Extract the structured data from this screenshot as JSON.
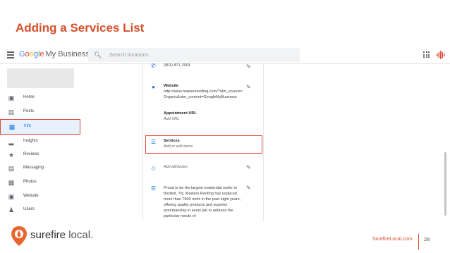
{
  "slide": {
    "title": "Adding a Services List",
    "footer_url": "SurefireLocal.com",
    "page_number": "28"
  },
  "topbar": {
    "logo_google": "Google",
    "logo_suffix": "My Business",
    "search_placeholder": "Search locations"
  },
  "sidebar": {
    "items": [
      {
        "label": "Home",
        "icon": "home-icon"
      },
      {
        "label": "Posts",
        "icon": "posts-icon"
      },
      {
        "label": "Info",
        "icon": "storefront-icon",
        "active": true
      },
      {
        "label": "Insights",
        "icon": "bar-chart-icon"
      },
      {
        "label": "Reviews",
        "icon": "star-icon"
      },
      {
        "label": "Messaging",
        "icon": "message-icon"
      },
      {
        "label": "Photos",
        "icon": "photos-icon"
      },
      {
        "label": "Website",
        "icon": "website-icon"
      },
      {
        "label": "Users",
        "icon": "add-user-icon"
      }
    ]
  },
  "info_panel": {
    "phone": "(901) 871-7663",
    "website_label": "Website",
    "website_url": "http://www.mastersroofing.com/?utm_source=Organic&utm_content=GoogleMyBusiness",
    "appointment_label": "Appointment URL",
    "appointment_value": "Add URL",
    "services_label": "Services",
    "services_value": "Add or edit items",
    "attributes_value": "Add attributes",
    "description": "Proud to be the largest residential roofer in Bartlett, TN, Masters Roofing has replaced more than 7500 roofs in the past eight years, offering quality products and superior workmanship in every job to address the particular needs of"
  },
  "footer": {
    "brand_prefix": "surefire",
    "brand_suffix": "local."
  },
  "colors": {
    "accent": "#d6502c",
    "highlight": "#e04a3a",
    "google_blue": "#1a73e8"
  }
}
